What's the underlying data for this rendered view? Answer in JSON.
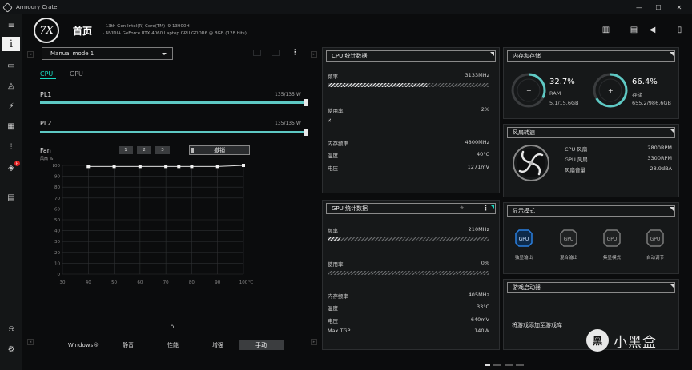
{
  "app": {
    "title": "Armoury Crate"
  },
  "window": {
    "minimize": "—",
    "maximize": "☐",
    "close": "✕"
  },
  "sidebar": {
    "items": [
      {
        "icon": "menu-icon",
        "glyph": "≡"
      },
      {
        "icon": "info-icon",
        "glyph": "i",
        "active": true
      },
      {
        "icon": "device-icon",
        "glyph": "▭"
      },
      {
        "icon": "aura-icon",
        "glyph": "◬"
      },
      {
        "icon": "armoury-icon",
        "glyph": "⚡"
      },
      {
        "icon": "game-library-icon",
        "glyph": "▦"
      },
      {
        "icon": "tuning-icon",
        "glyph": "⫶"
      },
      {
        "icon": "deals-icon",
        "glyph": "◈",
        "badge": "H"
      },
      {
        "icon": "news-icon",
        "glyph": "▤"
      }
    ],
    "bottom": [
      {
        "icon": "user-icon",
        "glyph": "⍾"
      },
      {
        "icon": "settings-icon",
        "glyph": "⚙"
      }
    ]
  },
  "header": {
    "logo_text": "7X",
    "title": "首页",
    "cpu": "13th Gen Intel(R) Core(TM) i9-13900H",
    "gpu": "NVIDIA GeForce RTX 4060 Laptop GPU GDDR6 @ 8GB (128 bits)",
    "bullet": "-"
  },
  "profile": {
    "mode": "Manual mode 1",
    "tabs": [
      "CPU",
      "GPU"
    ],
    "pl1": {
      "label": "PL1",
      "value": "135/135 W",
      "fraction": 1.0
    },
    "pl2": {
      "label": "PL2",
      "value": "135/135 W",
      "fraction": 1.0
    },
    "fan": {
      "label": "Fan",
      "sub": "风扇 %",
      "presets": [
        "1",
        "2",
        "3"
      ],
      "undo": "撤销"
    }
  },
  "chart_data": {
    "type": "line",
    "title": "",
    "xlabel": "℃",
    "ylabel": "风扇 %",
    "xlim": [
      30,
      100
    ],
    "ylim": [
      0,
      100
    ],
    "x_ticks": [
      30,
      40,
      50,
      60,
      70,
      80,
      90,
      100
    ],
    "y_ticks": [
      100,
      90,
      80,
      70,
      60,
      50,
      40,
      30,
      20,
      10,
      0
    ],
    "x_tick_labels": [
      "30",
      "40",
      "50",
      "60",
      "70",
      "80",
      "90",
      "100"
    ],
    "x_unit": "℃",
    "grid": true,
    "series": [
      {
        "x": [
          40,
          50,
          60,
          70,
          75,
          80,
          90,
          100
        ],
        "y": [
          99,
          99,
          99,
          99,
          99,
          99,
          99,
          100
        ]
      }
    ]
  },
  "modes": {
    "items": [
      "Windows®",
      "静音",
      "性能",
      "增强",
      "手动"
    ],
    "active": "手动"
  },
  "cpu_stats": {
    "title": "CPU 统计数据",
    "freq_label": "频率",
    "freq_value": "3133MHz",
    "freq_fraction": 0.62,
    "usage_label": "使用率",
    "usage_value": "2%",
    "usage_fraction": 0.02,
    "mem_freq_label": "内存频率",
    "mem_freq_value": "4800MHz",
    "temp_label": "温度",
    "temp_value": "40°C",
    "volt_label": "电压",
    "volt_value": "1271mV"
  },
  "gpu_stats": {
    "title": "GPU 统计数据",
    "freq_label": "频率",
    "freq_value": "210MHz",
    "freq_fraction": 0.08,
    "usage_label": "使用率",
    "usage_value": "0%",
    "usage_fraction": 0.0,
    "mem_freq_label": "内存频率",
    "mem_freq_value": "405MHz",
    "temp_label": "温度",
    "temp_value": "33°C",
    "volt_label": "电压",
    "volt_value": "640mV",
    "tgp_label": "Max TGP",
    "tgp_value": "140W"
  },
  "memory": {
    "title": "内存和存储",
    "ram_pct": "32.7%",
    "ram_label": "RAM",
    "ram_detail": "5.1/15.6GB",
    "ram_fraction": 0.327,
    "storage_pct": "66.4%",
    "storage_label": "存储",
    "storage_detail": "655.2/986.6GB",
    "storage_fraction": 0.664
  },
  "fans": {
    "title": "风扇转速",
    "rows": [
      {
        "label": "CPU 风扇",
        "value": "2800RPM"
      },
      {
        "label": "GPU 风扇",
        "value": "3300RPM"
      },
      {
        "label": "风扇音量",
        "value": "28.9dBA"
      }
    ]
  },
  "display": {
    "title": "显示模式",
    "modes": [
      {
        "label": "独显输出",
        "icon": "gpu-dedicated-icon",
        "active": true
      },
      {
        "label": "混合输出",
        "icon": "gpu-hybrid-icon",
        "active": false
      },
      {
        "label": "集显模式",
        "icon": "gpu-integrated-icon",
        "active": false
      },
      {
        "label": "自动调节",
        "icon": "gpu-auto-icon",
        "active": false
      }
    ]
  },
  "launcher": {
    "title": "游戏启动器",
    "message": "将游戏添加至游戏库"
  },
  "watermark": {
    "logo": "黑",
    "text": "小黑盒"
  },
  "colors": {
    "accent": "#19d9c0",
    "active_display": "#2a7fe0"
  }
}
